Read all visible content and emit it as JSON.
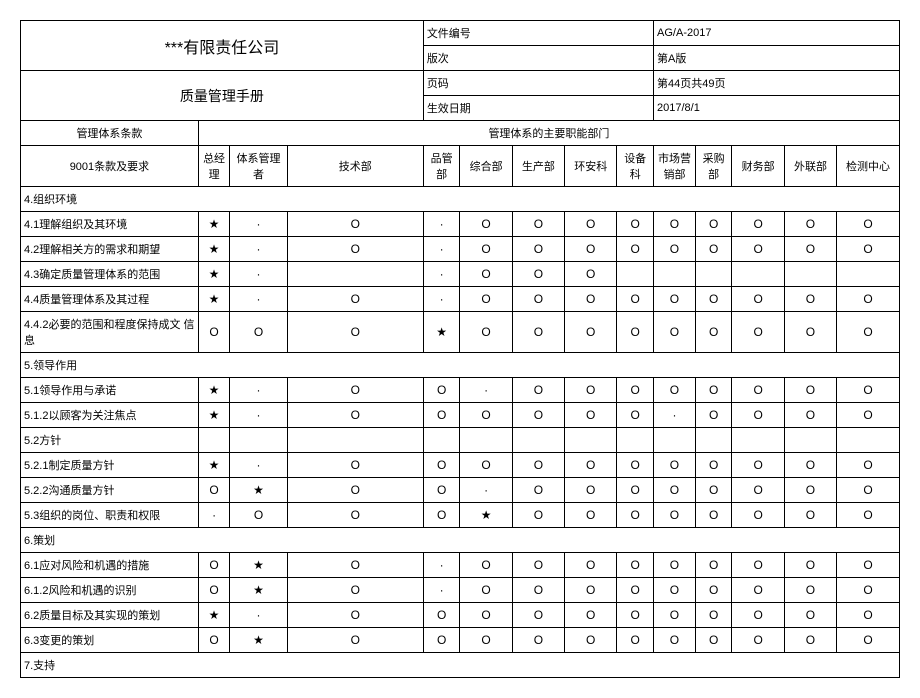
{
  "header": {
    "company": "***有限责任公司",
    "manual": "质量管理手册",
    "doc_no_label": "文件编号",
    "doc_no_value": "AG/A-2017",
    "rev_label": "版次",
    "rev_value": "第A版",
    "page_label": "页码",
    "page_value": "第44页共49页",
    "eff_label": "生效日期",
    "eff_value": "2017/8/1"
  },
  "subhead": {
    "clause": "管理体系条款",
    "depts": "管理体系的主要职能部门"
  },
  "cols": {
    "c0": "9001条款及要求",
    "c1": "总经理",
    "c2": "体系管理者",
    "c3": "技术部",
    "c4": "品管部",
    "c5": "综合部",
    "c6": "生产部",
    "c7": "环安科",
    "c8": "设备科",
    "c9": "市场营销部",
    "c10": "采购部",
    "c11": "财务部",
    "c12": "外联部",
    "c13": "检测中心"
  },
  "sym": {
    "star": "★",
    "dot": "·",
    "o": "O",
    "blank": ""
  },
  "rows": [
    {
      "label": "4.组织环境",
      "section": true
    },
    {
      "label": "4.1理解组织及其环境",
      "cells": [
        "star",
        "dot",
        "o",
        "dot",
        "o",
        "o",
        "o",
        "o",
        "o",
        "o",
        "o",
        "o",
        "o"
      ]
    },
    {
      "label": "4.2理解相关方的需求和期望",
      "cells": [
        "star",
        "dot",
        "o",
        "dot",
        "o",
        "o",
        "o",
        "o",
        "o",
        "o",
        "o",
        "o",
        "o"
      ]
    },
    {
      "label": "4.3确定质量管理体系的范围",
      "cells": [
        "star",
        "dot",
        "blank",
        "dot",
        "o",
        "o",
        "o",
        "blank",
        "blank",
        "blank",
        "blank",
        "blank",
        "blank"
      ]
    },
    {
      "label": "4.4质量管理体系及其过程",
      "cells": [
        "star",
        "dot",
        "o",
        "dot",
        "o",
        "o",
        "o",
        "o",
        "o",
        "o",
        "o",
        "o",
        "o"
      ]
    },
    {
      "label": "4.4.2必要的范围和程度保持成文 信息",
      "cells": [
        "o",
        "o",
        "o",
        "star",
        "o",
        "o",
        "o",
        "o",
        "o",
        "o",
        "o",
        "o",
        "o"
      ]
    },
    {
      "label": "5.领导作用",
      "section": true
    },
    {
      "label": "5.1领导作用与承诺",
      "cells": [
        "star",
        "dot",
        "o",
        "o",
        "dot",
        "o",
        "o",
        "o",
        "o",
        "o",
        "o",
        "o",
        "o"
      ]
    },
    {
      "label": "5.1.2以顾客为关注焦点",
      "cells": [
        "star",
        "dot",
        "o",
        "o",
        "o",
        "o",
        "o",
        "o",
        "dot",
        "o",
        "o",
        "o",
        "o"
      ]
    },
    {
      "label": "5.2方针",
      "cells": [
        "blank",
        "blank",
        "blank",
        "blank",
        "blank",
        "blank",
        "blank",
        "blank",
        "blank",
        "blank",
        "blank",
        "blank",
        "blank"
      ]
    },
    {
      "label": "5.2.1制定质量方针",
      "cells": [
        "star",
        "dot",
        "o",
        "o",
        "o",
        "o",
        "o",
        "o",
        "o",
        "o",
        "o",
        "o",
        "o"
      ]
    },
    {
      "label": "5.2.2沟通质量方针",
      "cells": [
        "o",
        "star",
        "o",
        "o",
        "dot",
        "o",
        "o",
        "o",
        "o",
        "o",
        "o",
        "o",
        "o"
      ]
    },
    {
      "label": "5.3组织的岗位、职责和权限",
      "cells": [
        "dot",
        "o",
        "o",
        "o",
        "star",
        "o",
        "o",
        "o",
        "o",
        "o",
        "o",
        "o",
        "o"
      ]
    },
    {
      "label": "6.策划",
      "section": true
    },
    {
      "label": "6.1应对风险和机遇的措施",
      "cells": [
        "o",
        "star",
        "o",
        "dot",
        "o",
        "o",
        "o",
        "o",
        "o",
        "o",
        "o",
        "o",
        "o"
      ]
    },
    {
      "label": "6.1.2风险和机遇的识别",
      "cells": [
        "o",
        "star",
        "o",
        "dot",
        "o",
        "o",
        "o",
        "o",
        "o",
        "o",
        "o",
        "o",
        "o"
      ]
    },
    {
      "label": "6.2质量目标及其实现的策划",
      "cells": [
        "star",
        "dot",
        "o",
        "o",
        "o",
        "o",
        "o",
        "o",
        "o",
        "o",
        "o",
        "o",
        "o"
      ]
    },
    {
      "label": "6.3变更的策划",
      "cells": [
        "o",
        "star",
        "o",
        "o",
        "o",
        "o",
        "o",
        "o",
        "o",
        "o",
        "o",
        "o",
        "o"
      ]
    },
    {
      "label": "7.支持",
      "section": true
    }
  ]
}
